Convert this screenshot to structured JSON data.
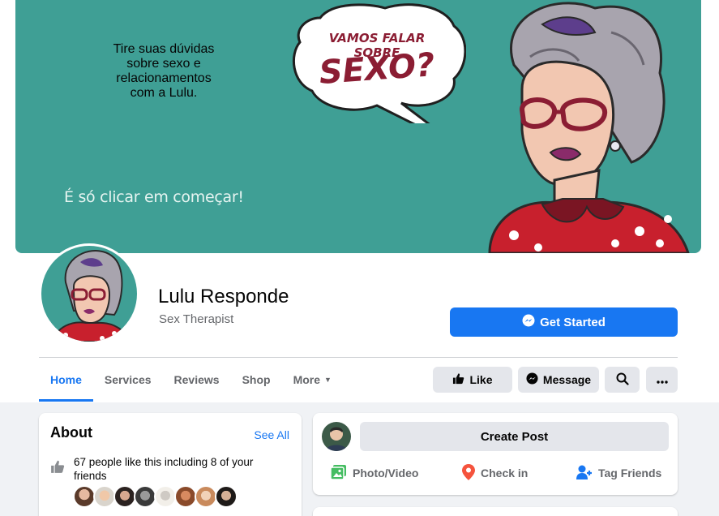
{
  "cover": {
    "headline": "Tire suas dúvidas\nsobre sexo e\nrelacionamentos\ncom a Lulu.",
    "cta_text": "É só clicar em começar!",
    "bubble_top": "VAMOS FALAR SOBRE",
    "bubble_main": "SEXO?",
    "background_color": "#3f9f95"
  },
  "profile": {
    "name": "Lulu Responde",
    "category": "Sex Therapist",
    "cta_button": {
      "label": "Get Started",
      "icon": "messenger-icon",
      "color": "#1877f2"
    }
  },
  "tabs": [
    {
      "label": "Home",
      "active": true
    },
    {
      "label": "Services",
      "active": false
    },
    {
      "label": "Reviews",
      "active": false
    },
    {
      "label": "Shop",
      "active": false
    },
    {
      "label": "More",
      "active": false
    }
  ],
  "actions": {
    "like_label": "Like",
    "message_label": "Message",
    "search_icon": "search-icon",
    "more_icon": "more-dots-icon"
  },
  "about": {
    "title": "About",
    "see_all": "See All",
    "likes_text": "67 people like this including 8 of your friends",
    "friend_count_shown": 8
  },
  "create_post": {
    "button_label": "Create Post",
    "options": [
      {
        "label": "Photo/Video",
        "icon": "photo-video-icon",
        "color": "#45bd62"
      },
      {
        "label": "Check in",
        "icon": "location-pin-icon",
        "color": "#f5533d"
      },
      {
        "label": "Tag Friends",
        "icon": "tag-friends-icon",
        "color": "#1877f2"
      }
    ]
  },
  "colors": {
    "accent": "#1877f2",
    "page_bg": "#f0f2f5",
    "muted_text": "#65676b"
  }
}
